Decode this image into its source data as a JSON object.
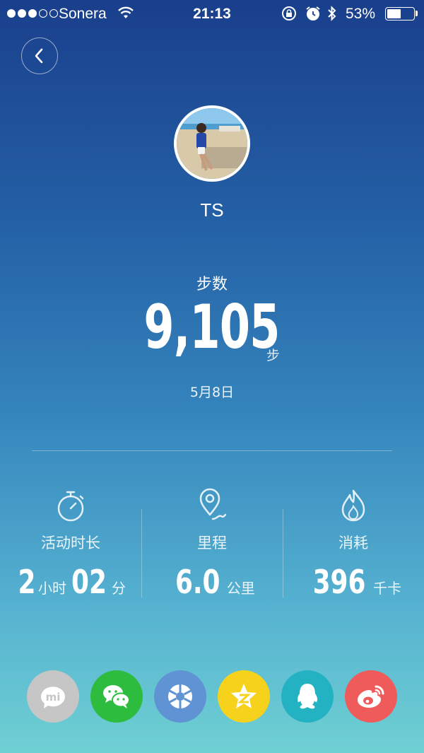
{
  "status_bar": {
    "carrier": "Sonera",
    "time": "21:13",
    "battery_percent": "53%",
    "battery_level": 0.53,
    "signal_strength": 3,
    "signal_max": 5
  },
  "profile": {
    "name": "TS"
  },
  "steps": {
    "label": "步数",
    "value": "9,105",
    "unit": "步",
    "date": "5月8日"
  },
  "stats": [
    {
      "icon": "stopwatch-icon",
      "label": "活动时长",
      "hours": "2",
      "hours_unit": "小时",
      "minutes": "02",
      "minutes_unit": "分"
    },
    {
      "icon": "location-pin-icon",
      "label": "里程",
      "value": "6.0",
      "unit": "公里"
    },
    {
      "icon": "flame-icon",
      "label": "消耗",
      "value": "396",
      "unit": "千卡"
    }
  ],
  "share": [
    {
      "icon": "mi-icon",
      "color": "#c6c6c6"
    },
    {
      "icon": "wechat-icon",
      "color": "#2dbc3e"
    },
    {
      "icon": "moments-icon",
      "color": "#5f93d3"
    },
    {
      "icon": "qzone-icon",
      "color": "#f7d21c"
    },
    {
      "icon": "qq-icon",
      "color": "#22b2c2"
    },
    {
      "icon": "weibo-icon",
      "color": "#ef5b5b"
    }
  ]
}
